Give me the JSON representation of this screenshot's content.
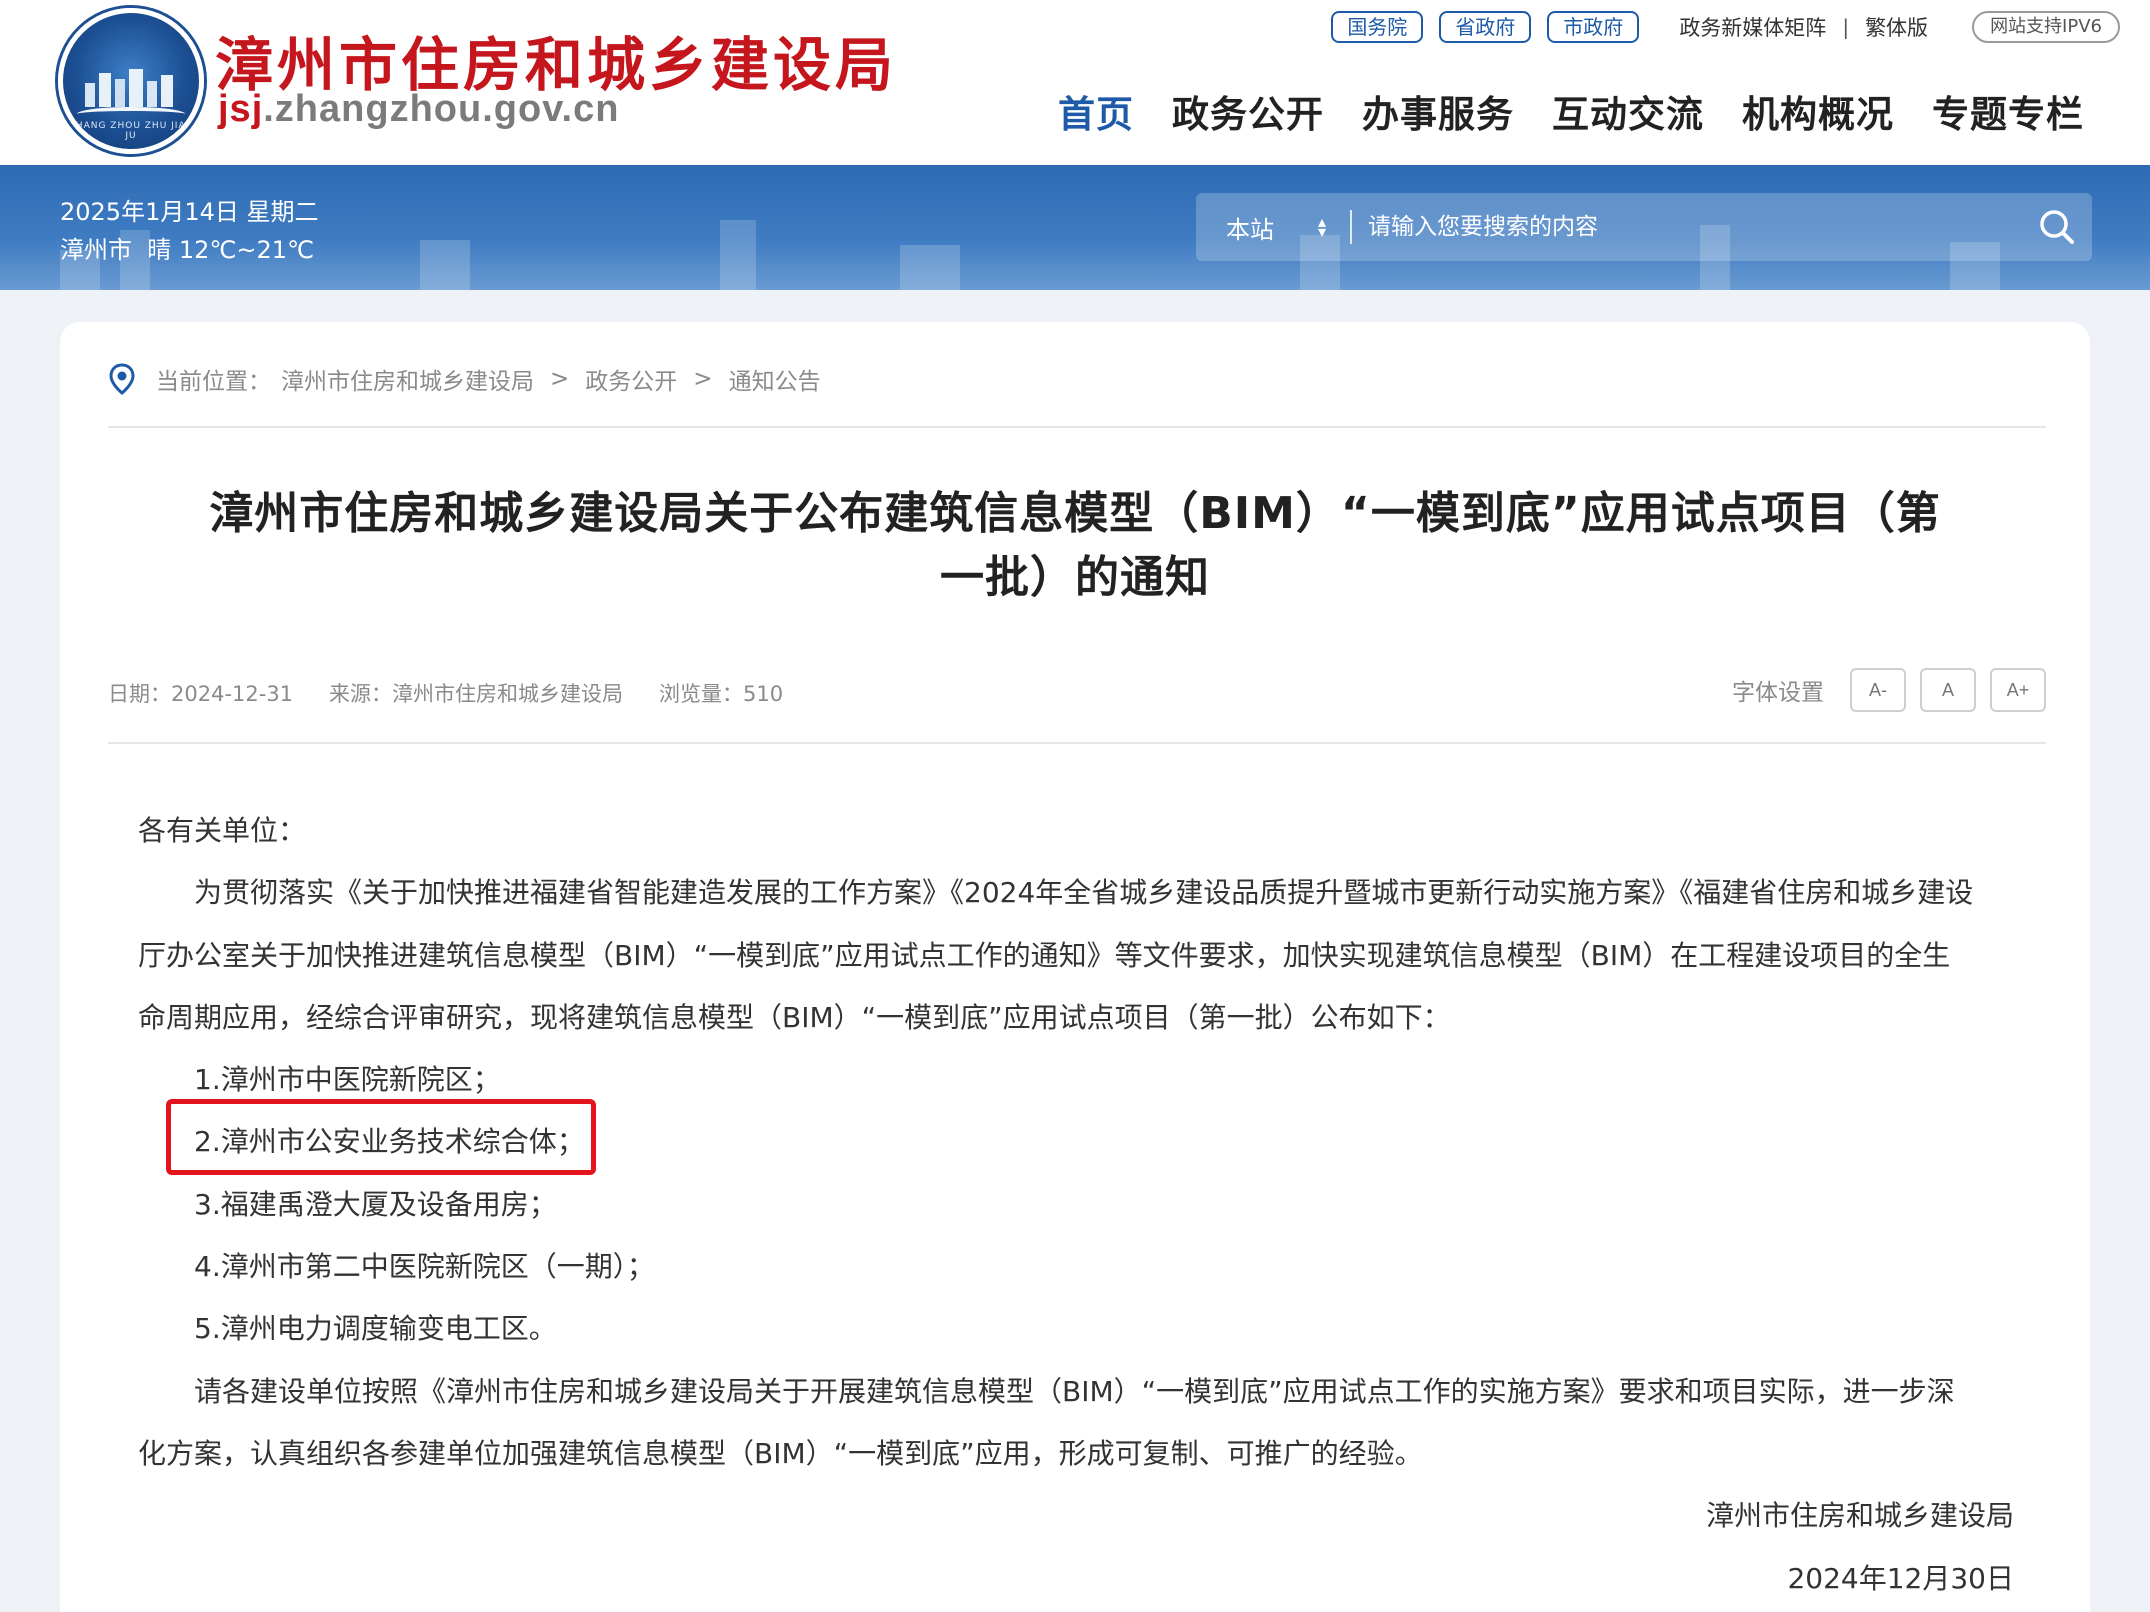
{
  "header": {
    "site_title": "漳州市住房和城乡建设局",
    "domain_prefix": "jsj",
    "domain_rest": ".zhangzhou.gov.cn",
    "emblem_text": "ZHANG ZHOU ZHU JIAN JU",
    "gov_links": [
      "国务院",
      "省政府",
      "市政府"
    ],
    "media_matrix": "政务新媒体矩阵",
    "separator": "|",
    "traditional": "繁体版",
    "ipv6": "网站支持IPV6",
    "nav": [
      "首页",
      "政务公开",
      "办事服务",
      "互动交流",
      "机构概况",
      "专题专栏"
    ],
    "active_nav": "首页"
  },
  "banner": {
    "date": "2025年1月14日 星期二",
    "weather": "漳州市  晴 12℃~21℃",
    "search_scope": "本站",
    "search_placeholder": "请输入您要搜索的内容"
  },
  "breadcrumb": {
    "label": "当前位置：",
    "items": [
      "漳州市住房和城乡建设局",
      "政务公开",
      "通知公告"
    ],
    "sep": ">"
  },
  "article": {
    "title_line1": "漳州市住房和城乡建设局关于公布建筑信息模型（BIM）“一模到底”应用试点项目（第",
    "title_line2": "一批）的通知",
    "date": "日期：2024-12-31",
    "source": "来源：漳州市住房和城乡建设局",
    "views": "浏览量：510",
    "font_setting_label": "字体设置",
    "font_buttons": [
      "A-",
      "A",
      "A+"
    ],
    "salutation": "各有关单位：",
    "para1_line1": "为贯彻落实《关于加快推进福建省智能建造发展的工作方案》《2024年全省城乡建设品质提升暨城市更新行动实施方案》《福建省住房和城乡建设",
    "para1_line2": "厅办公室关于加快推进建筑信息模型（BIM）“一模到底”应用试点工作的通知》等文件要求，加快实现建筑信息模型（BIM）在工程建设项目的全生",
    "para1_line3": "命周期应用，经综合评审研究，现将建筑信息模型（BIM）“一模到底”应用试点项目（第一批）公布如下：",
    "items": [
      "1.漳州市中医院新院区；",
      "2.漳州市公安业务技术综合体；",
      "3.福建禹澄大厦及设备用房；",
      "4.漳州市第二中医院新院区（一期）；",
      "5.漳州电力调度输变电工区。"
    ],
    "para2_line1": "请各建设单位按照《漳州市住房和城乡建设局关于开展建筑信息模型（BIM）“一模到底”应用试点工作的实施方案》要求和项目实际，进一步深",
    "para2_line2": "化方案，认真组织各参建单位加强建筑信息模型（BIM）“一模到底”应用，形成可复制、可推广的经验。",
    "signature": "漳州市住房和城乡建设局",
    "sign_date": "2024年12月30日"
  },
  "colors": {
    "brand_red": "#c4161c",
    "brand_blue": "#1d5aa8",
    "highlight_red": "#e3141c"
  }
}
